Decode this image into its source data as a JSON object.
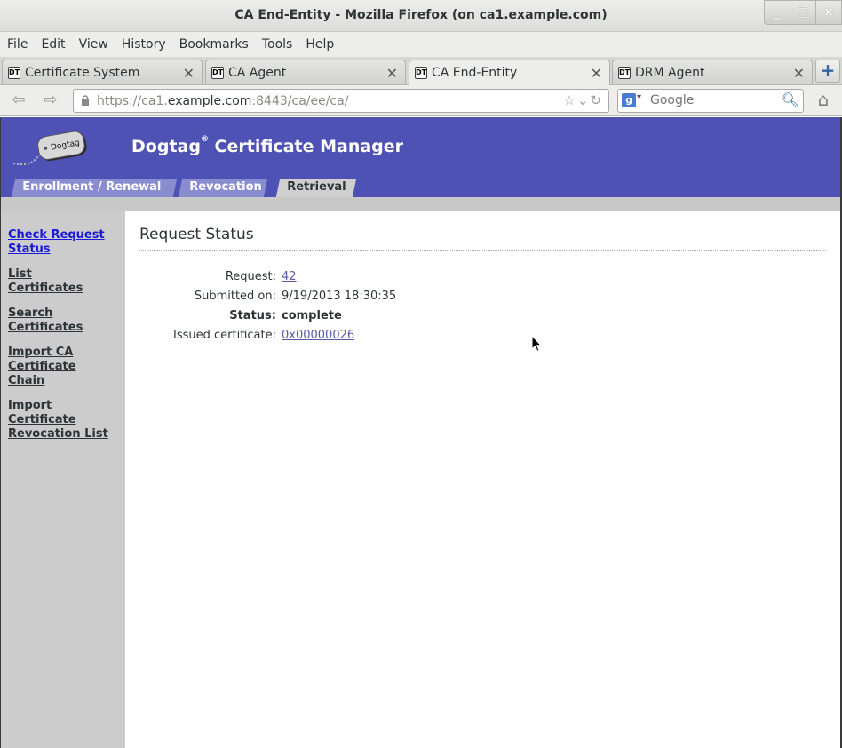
{
  "window": {
    "title": "CA End-Entity - Mozilla Firefox (on ca1.example.com)",
    "buttons": [
      "_",
      "□",
      "×"
    ]
  },
  "menu": [
    "File",
    "Edit",
    "View",
    "History",
    "Bookmarks",
    "Tools",
    "Help"
  ],
  "tabs": [
    {
      "label": "Certificate System",
      "favicon": "DT"
    },
    {
      "label": "CA Agent",
      "favicon": "DT"
    },
    {
      "label": "CA End-Entity",
      "favicon": "DT",
      "active": true
    },
    {
      "label": "DRM Agent",
      "favicon": "DT"
    }
  ],
  "new_tab_label": "+",
  "url": {
    "prefix": "https://ca1.",
    "host": "example.com",
    "suffix": ":8443/ca/ee/ca/"
  },
  "search": {
    "placeholder": "Google",
    "engine_letter": "g"
  },
  "header": {
    "logo_text": "Dogtag",
    "product": "Dogtag",
    "registered": "®",
    "product_rest": " Certificate Manager",
    "nav": [
      "Enrollment / Renewal",
      "Revocation",
      "Retrieval"
    ]
  },
  "sidebar": {
    "links": [
      [
        "Check Request",
        "Status"
      ],
      [
        "List",
        "Certificates"
      ],
      [
        "Search",
        "Certificates"
      ],
      [
        "Import CA",
        "Certificate",
        "Chain"
      ],
      [
        "Import",
        "Certificate",
        "Revocation List"
      ]
    ]
  },
  "content": {
    "heading": "Request Status",
    "rows": {
      "request": {
        "label": "Request:",
        "value": "42"
      },
      "submitted": {
        "label": "Submitted on:",
        "value": "9/19/2013 18:30:35"
      },
      "status": {
        "label": "Status:",
        "value": "complete"
      },
      "issued": {
        "label": "Issued certificate:",
        "value": "0x00000026"
      }
    }
  },
  "colors": {
    "header_bg": "#4f52b5",
    "sidebar_bg": "#cccccc",
    "link": "#5a5aa8",
    "active_side_link": "#1a1ad6"
  }
}
